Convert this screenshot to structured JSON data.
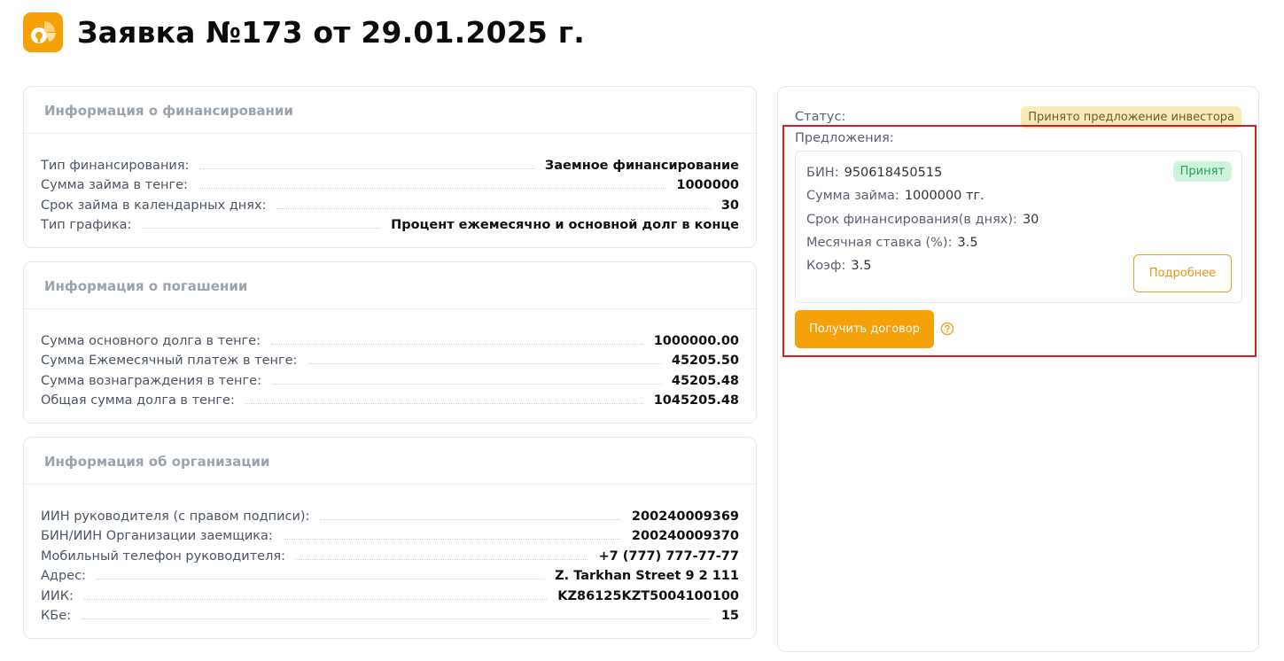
{
  "page": {
    "title": "Заявка №173 от 29.01.2025 г."
  },
  "colors": {
    "accent": "#f5a20a",
    "highlight_border": "#e0191f",
    "status_badge_bg": "#fbeab8",
    "accepted_badge_bg": "#cdf3dd"
  },
  "financing": {
    "heading": "Информация о финансировании",
    "rows": [
      {
        "label": "Тип финансирования:",
        "value": "Заемное финансирование"
      },
      {
        "label": "Сумма займа в тенге:",
        "value": "1000000"
      },
      {
        "label": "Срок займа в календарных днях:",
        "value": "30"
      },
      {
        "label": "Тип графика:",
        "value": "Процент ежемесячно и основной долг в конце"
      }
    ]
  },
  "repayment": {
    "heading": "Информация о погашении",
    "rows": [
      {
        "label": "Сумма основного долга в тенге:",
        "value": "1000000.00"
      },
      {
        "label": "Сумма Ежемесячный платеж в тенге:",
        "value": "45205.50"
      },
      {
        "label": "Сумма вознаграждения в тенге:",
        "value": "45205.48"
      },
      {
        "label": "Общая сумма долга в тенге:",
        "value": "1045205.48"
      }
    ]
  },
  "organization": {
    "heading": "Информация об организации",
    "rows": [
      {
        "label": "ИИН руководителя (с правом подписи):",
        "value": "200240009369"
      },
      {
        "label": "БИН/ИИН Организации заемщика:",
        "value": "200240009370"
      },
      {
        "label": "Мобильный телефон руководителя:",
        "value": "+7 (777) 777-77-77"
      },
      {
        "label": "Адрес:",
        "value": "Z. Tarkhan Street 9 2 111"
      },
      {
        "label": "ИИК:",
        "value": "KZ86125KZT5004100100"
      },
      {
        "label": "КБе:",
        "value": "15"
      }
    ]
  },
  "side": {
    "status_label": "Статус:",
    "status_value": "Принято предложение инвестора",
    "offers_label": "Предложения:",
    "offer": {
      "bin_label": "БИН:",
      "bin_value": "950618450515",
      "amount_label": "Сумма займа:",
      "amount_value": "1000000 тг.",
      "term_label": "Срок финансирования(в днях):",
      "term_value": "30",
      "rate_label": "Месячная ставка (%):",
      "rate_value": "3.5",
      "coef_label": "Коэф:",
      "coef_value": "3.5",
      "accepted_badge": "Принят",
      "details_button": "Подробнее"
    },
    "contract_button": "Получить договор",
    "help_icon": "question-circle-icon"
  }
}
